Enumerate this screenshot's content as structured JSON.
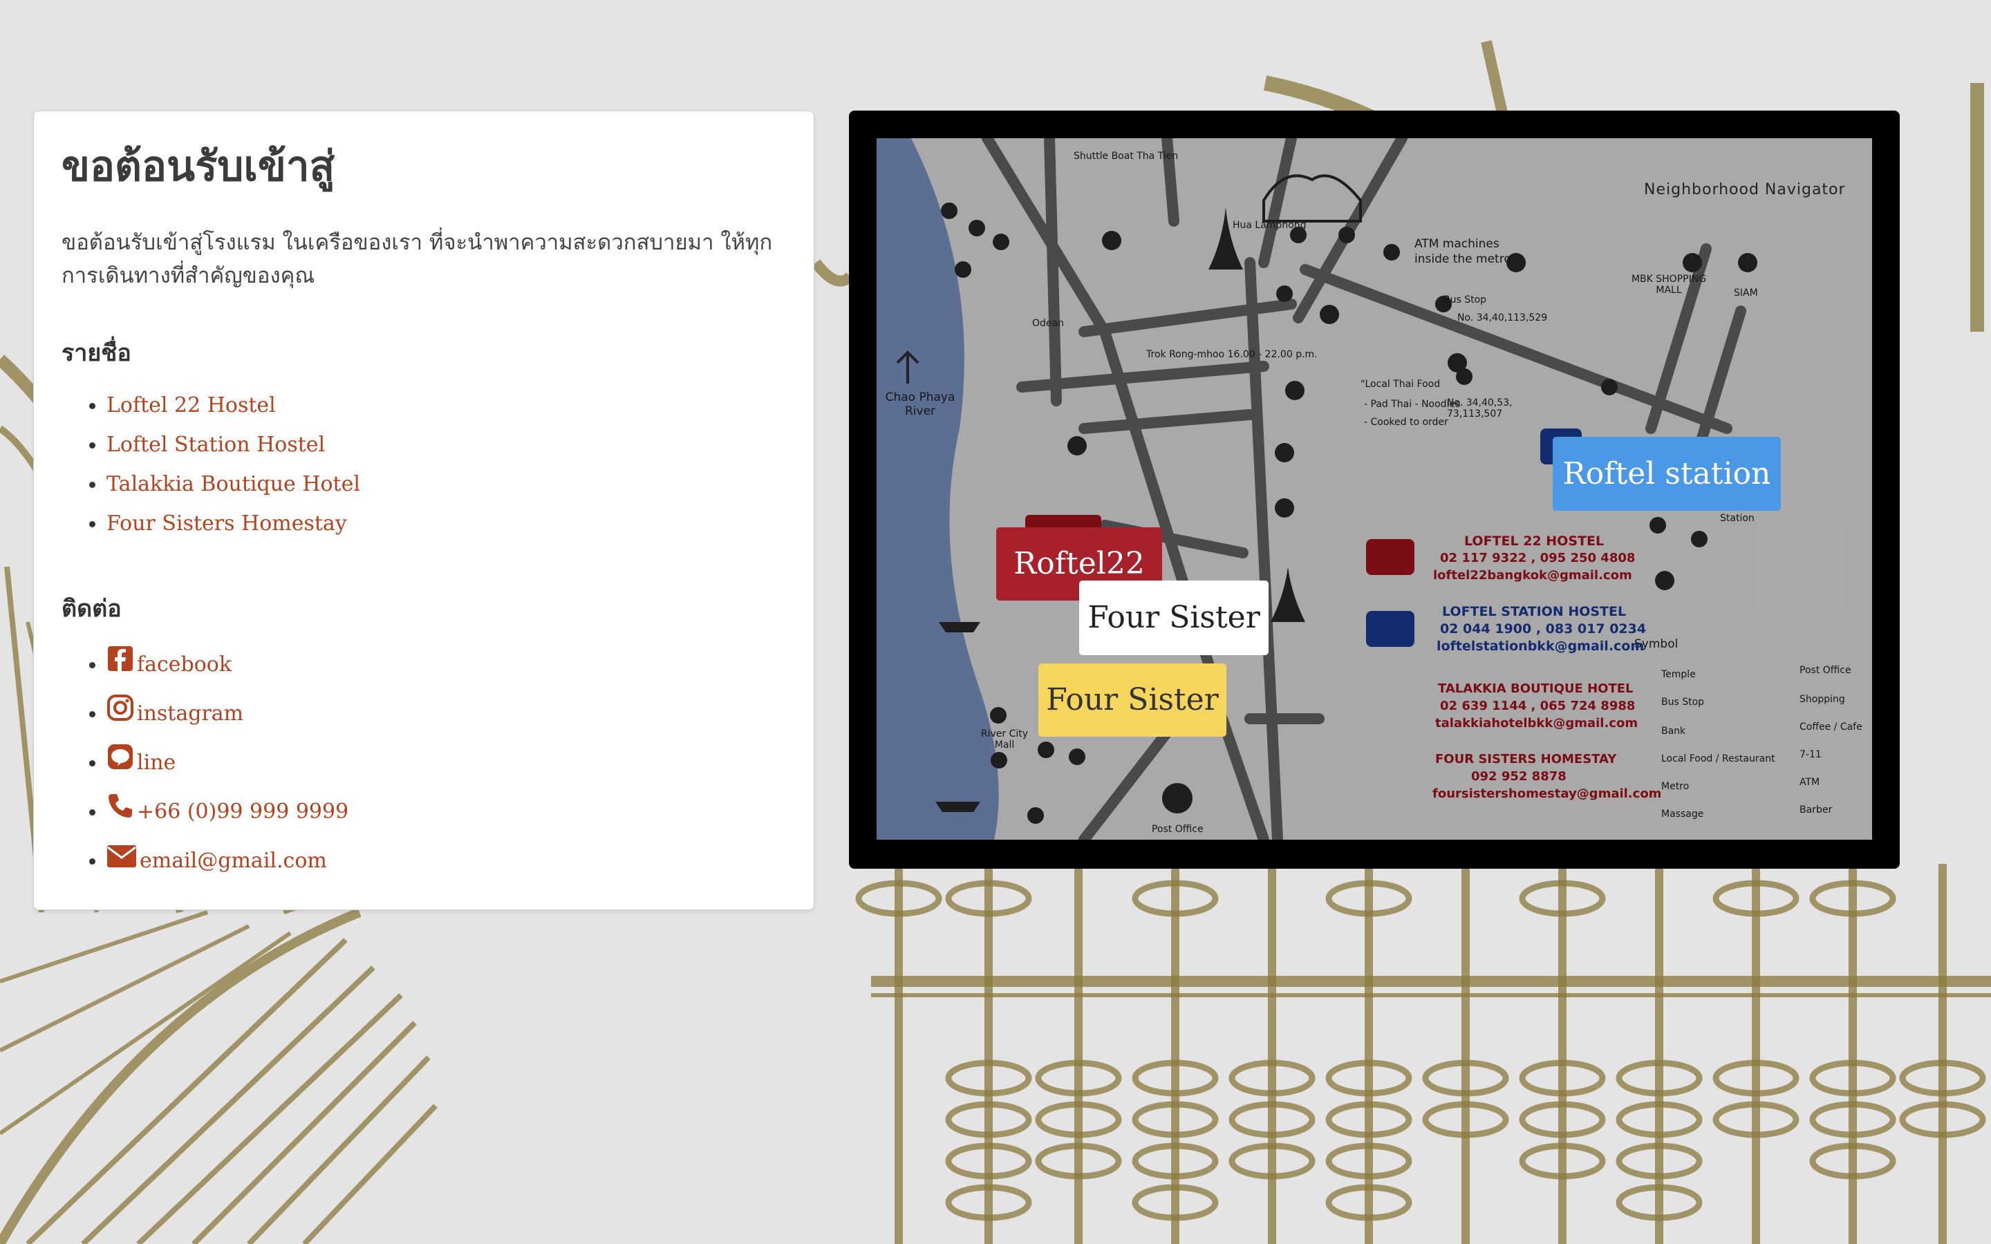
{
  "welcome": {
    "title": "ขอต้อนรับเข้าสู่",
    "intro": "ขอต้อนรับเข้าสู่โรงแรม ในเครือของเรา ที่จะนำพาความสะดวกสบายมา ให้ทุกการเดินทางที่สำคัญของคุณ"
  },
  "list": {
    "heading": "รายชื่อ",
    "items": [
      "Loftel 22 Hostel",
      "Loftel Station Hostel",
      "Talakkia Boutique Hotel",
      "Four Sisters Homestay"
    ]
  },
  "contact": {
    "heading": "ติดต่อ",
    "items": [
      {
        "label": "facebook",
        "icon": "facebook-icon"
      },
      {
        "label": "instagram",
        "icon": "instagram-icon"
      },
      {
        "label": "line",
        "icon": "line-icon"
      },
      {
        "label": "+66 (0)99 999 9999",
        "icon": "phone-icon"
      },
      {
        "label": "email@gmail.com",
        "icon": "envelope-icon"
      }
    ]
  },
  "map": {
    "title": "Neighborhood Navigator",
    "labels": {
      "shuttle": "Shuttle Boat Tha Tien",
      "hua_lamphong": "Hua Lamphong",
      "atm": "ATM machines inside the metro",
      "mbk": "MBK SHOPPING MALL",
      "siam": "SIAM",
      "odean": "Odean",
      "bus_stop": "Bus Stop",
      "bus_no": "No. 34,40,113,529",
      "bus_no2": "No. 34,40,53, 73,113,507",
      "trok": "Trok Rong-mhoo 16.00 - 22.00 p.m.",
      "chao_phraya": "Chao Phaya River",
      "local_food": "\"Local Thai Food",
      "food_list": "- Pad Thai - Noodles - Cooked to order",
      "station": "Station",
      "symbol": "Symbol",
      "post_office": "Post Office",
      "river_city": "River City Mall",
      "loftel22": "LOFTEL 22 HOSTEL",
      "loftel22_phone": "02 117 9322 , 095 250 4808",
      "loftel22_mail": "loftel22bangkok@gmail.com",
      "station_hostel": "LOFTEL STATION HOSTEL",
      "station_phone": "02 044 1900 , 083 017 0234",
      "station_mail": "loftelstationbkk@gmail.com",
      "talakkia": "TALAKKIA BOUTIQUE HOTEL",
      "talakkia_phone": "02 639 1144 , 065 724 8988",
      "talakkia_mail": "talakkiahotelbkk@gmail.com",
      "four_sisters": "FOUR SISTERS HOMESTAY",
      "four_sisters_phone": "092 952 8878",
      "four_sisters_mail": "foursistershomestay@gmail.com",
      "sym_temple": "Temple",
      "sym_bus": "Bus Stop",
      "sym_bank": "Bank",
      "sym_food": "Local Food / Restaurant",
      "sym_metro": "Metro",
      "sym_massage": "Massage",
      "sym_post": "Post Office",
      "sym_shopping": "Shopping",
      "sym_coffee": "Coffee / Cafe",
      "sym_711": "7-11",
      "sym_atm": "ATM",
      "sym_barber": "Barber"
    },
    "markers": {
      "roftel22": "Roftel22",
      "four_sister_white": "Four Sister",
      "four_sister_yellow": "Four Sister",
      "roftel_station": "Roftel station"
    }
  },
  "colors": {
    "link": "#b5421e",
    "marker_red": "#a8202a",
    "marker_yellow": "#f6d55c",
    "marker_blue": "#4a98e6",
    "sketch": "#8a7a3e"
  }
}
